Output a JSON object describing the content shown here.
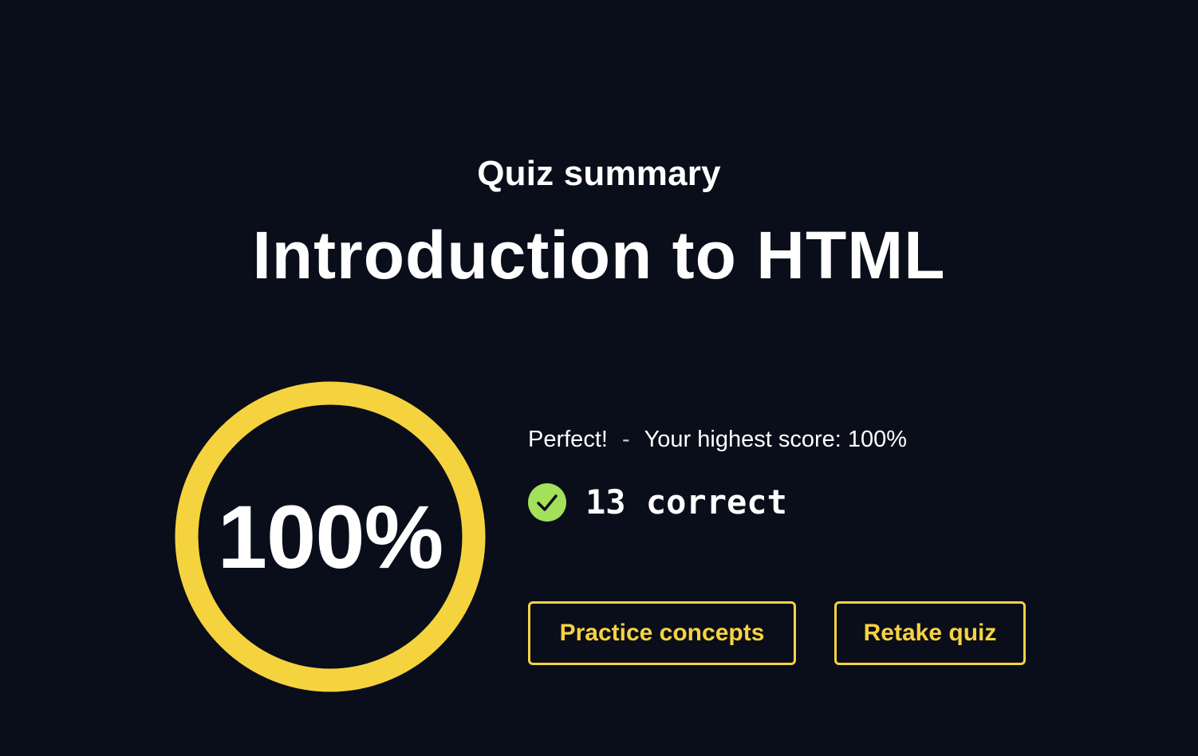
{
  "header": {
    "kicker": "Quiz summary",
    "title": "Introduction to HTML"
  },
  "score": {
    "percent_label": "100%",
    "percent_value": 100,
    "ring_color": "#f5d33f"
  },
  "result": {
    "verdict": "Perfect!",
    "separator": "-",
    "highest_score": "Your highest score: 100%",
    "check_icon": "check-circle-icon",
    "check_color": "#a3e15a",
    "correct_label": "13 correct"
  },
  "actions": {
    "practice_label": "Practice concepts",
    "retake_label": "Retake quiz",
    "accent": "#f5d33f"
  }
}
